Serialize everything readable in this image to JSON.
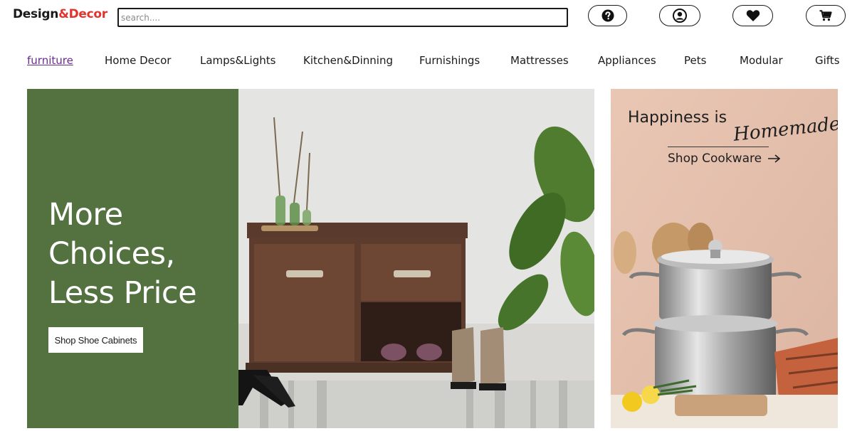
{
  "header": {
    "logo_part1": "Design",
    "logo_part2": "&Decor",
    "search_placeholder": "search....",
    "buttons": [
      {
        "icon": "question-circle-icon"
      },
      {
        "icon": "user-circle-icon"
      },
      {
        "icon": "heart-icon"
      },
      {
        "icon": "cart-icon"
      }
    ]
  },
  "nav": {
    "items": [
      "furniture",
      "Home Decor",
      "Lamps&Lights",
      "Kitchen&Dinning",
      "Furnishings",
      "Mattresses",
      "Appliances",
      "Pets",
      "Modular",
      "Gifts"
    ],
    "active_index": 0
  },
  "hero": {
    "headline_lines": [
      "More",
      "Choices,",
      "Less Price"
    ],
    "cta_label": "Shop Shoe Cabinets",
    "panel_color": "#537240"
  },
  "side_banner": {
    "headline": "Happiness is",
    "headline_script": "Homemade",
    "cta_label": "Shop Cookware"
  },
  "colors": {
    "brand_dark": "#1a1a1a",
    "brand_accent": "#e2342d",
    "nav_active": "#6b2c91"
  }
}
